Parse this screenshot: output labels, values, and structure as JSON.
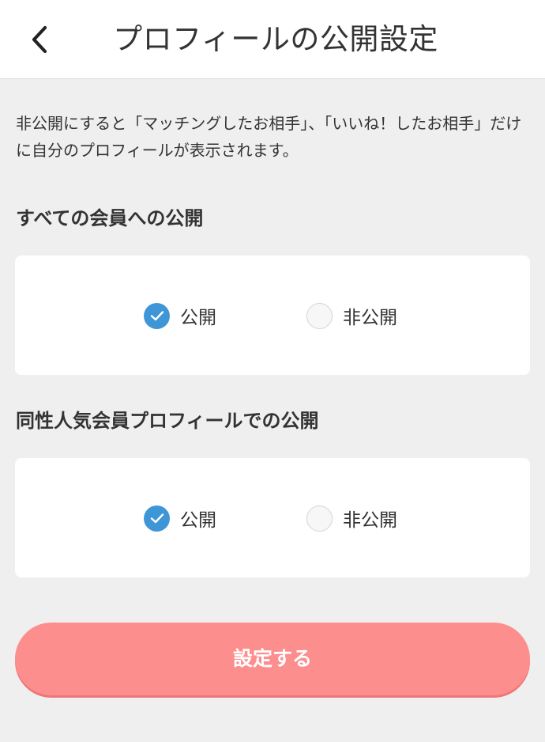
{
  "header": {
    "title": "プロフィールの公開設定",
    "back_icon": "chevron-left-icon"
  },
  "description": "非公開にすると「マッチングしたお相手」、「いいね！したお相手」だけに自分のプロフィールが表示されます。",
  "sections": [
    {
      "heading": "すべての会員への公開",
      "options": [
        {
          "label": "公開",
          "checked": true
        },
        {
          "label": "非公開",
          "checked": false
        }
      ]
    },
    {
      "heading": "同性人気会員プロフィールでの公開",
      "options": [
        {
          "label": "公開",
          "checked": true
        },
        {
          "label": "非公開",
          "checked": false
        }
      ]
    }
  ],
  "submit": {
    "label": "設定する"
  },
  "colors": {
    "accent": "#3e96d6",
    "submit_button": "#fd8e8e",
    "background": "#efefef"
  }
}
